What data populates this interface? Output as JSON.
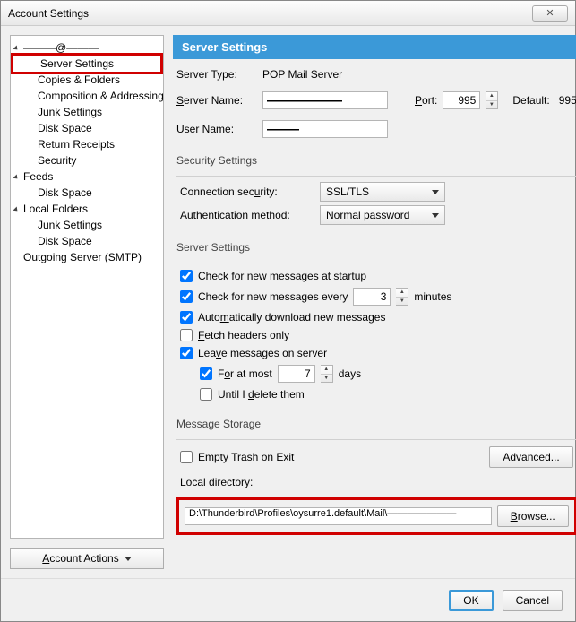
{
  "window": {
    "title": "Account Settings",
    "close_x": "✕"
  },
  "sidebar": {
    "account1": "———@———",
    "items1": [
      "Server Settings",
      "Copies & Folders",
      "Composition & Addressing",
      "Junk Settings",
      "Disk Space",
      "Return Receipts",
      "Security"
    ],
    "feeds": "Feeds",
    "feeds_items": [
      "Disk Space"
    ],
    "local": "Local Folders",
    "local_items": [
      "Junk Settings",
      "Disk Space"
    ],
    "smtp": "Outgoing Server (SMTP)",
    "actions_label": "Account Actions"
  },
  "header": "Server Settings",
  "serverType": {
    "label": "Server Type:",
    "value": "POP Mail Server"
  },
  "serverName": {
    "label": "Server Name:",
    "value": "———————"
  },
  "port": {
    "label": "Port:",
    "value": "995",
    "default_label": "Default:",
    "default_value": "995"
  },
  "userName": {
    "label": "User Name:",
    "value": "———"
  },
  "security": {
    "title": "Security Settings",
    "conn_label": "Connection security:",
    "conn_value": "SSL/TLS",
    "auth_label": "Authentication method:",
    "auth_value": "Normal password"
  },
  "server": {
    "title": "Server Settings",
    "check_startup": "Check for new messages at startup",
    "check_every_pre": "Check for new messages every",
    "check_every_val": "3",
    "check_every_post": "minutes",
    "auto_download": "Automatically download new messages",
    "fetch_headers": "Fetch headers only",
    "leave_server": "Leave messages on server",
    "at_most_pre": "For at most",
    "at_most_val": "7",
    "at_most_post": "days",
    "until_delete": "Until I delete them"
  },
  "storage": {
    "title": "Message Storage",
    "empty_trash": "Empty Trash on Exit",
    "advanced": "Advanced...",
    "local_dir_label": "Local directory:",
    "local_dir_value": "D:\\Thunderbird\\Profiles\\oysurre1.default\\Mail\\———————",
    "browse": "Browse..."
  },
  "footer": {
    "ok": "OK",
    "cancel": "Cancel"
  }
}
